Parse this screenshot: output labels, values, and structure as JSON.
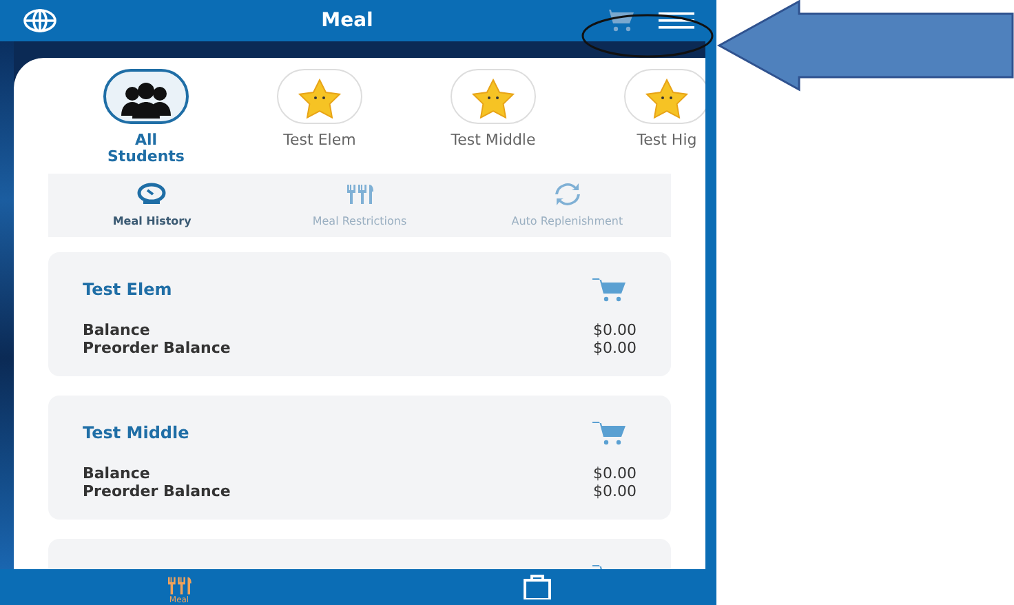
{
  "app_bar": {
    "title": "Meal"
  },
  "students": [
    {
      "name": "All Students",
      "kind": "group",
      "selected": true
    },
    {
      "name": "Test Elem",
      "kind": "star",
      "selected": false
    },
    {
      "name": "Test Middle",
      "kind": "star",
      "selected": false
    },
    {
      "name": "Test Hig",
      "kind": "star",
      "selected": false
    }
  ],
  "tabs": [
    {
      "label": "Meal History",
      "selected": true
    },
    {
      "label": "Meal Restrictions",
      "selected": false
    },
    {
      "label": "Auto Replenishment",
      "selected": false
    }
  ],
  "cards": [
    {
      "kind": "full",
      "name": "Test Elem",
      "rows": [
        {
          "label": "Balance",
          "value": "$0.00"
        },
        {
          "label": "Preorder Balance",
          "value": "$0.00"
        }
      ]
    },
    {
      "kind": "full",
      "name": "Test Middle",
      "rows": [
        {
          "label": "Balance",
          "value": "$0.00"
        },
        {
          "label": "Preorder Balance",
          "value": "$0.00"
        }
      ]
    },
    {
      "kind": "cut"
    }
  ],
  "bottom_nav": [
    {
      "label": "Meal",
      "selected": true
    },
    {
      "selected": false
    }
  ]
}
